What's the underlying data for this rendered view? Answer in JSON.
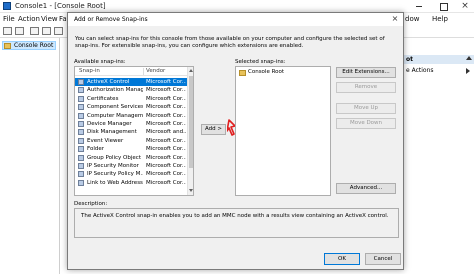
{
  "mmc": {
    "title": "Console1 - [Console Root]",
    "close_glyph": "×",
    "menu": [
      "File",
      "Action",
      "View",
      "Fa"
    ],
    "menu_right": [
      "dow",
      "Help"
    ],
    "tree_root": "Console Root",
    "actions_header": "ot",
    "actions_item": "e Actions"
  },
  "dialog": {
    "title": "Add or Remove Snap-ins",
    "close_glyph": "×",
    "intro": "You can select snap-ins for this console from those available on your computer and configure the selected set of snap-ins. For extensible snap-ins, you can configure which extensions are enabled.",
    "available_label": "Available snap-ins:",
    "col_snapin": "Snap-in",
    "col_vendor": "Vendor",
    "snapins": [
      {
        "name": "ActiveX Control",
        "vendor": "Microsoft Cor...",
        "selected": true
      },
      {
        "name": "Authorization Manager",
        "vendor": "Microsoft Cor..."
      },
      {
        "name": "Certificates",
        "vendor": "Microsoft Cor..."
      },
      {
        "name": "Component Services",
        "vendor": "Microsoft Cor..."
      },
      {
        "name": "Computer Managem...",
        "vendor": "Microsoft Cor..."
      },
      {
        "name": "Device Manager",
        "vendor": "Microsoft Cor..."
      },
      {
        "name": "Disk Management",
        "vendor": "Microsoft and..."
      },
      {
        "name": "Event Viewer",
        "vendor": "Microsoft Cor..."
      },
      {
        "name": "Folder",
        "vendor": "Microsoft Cor..."
      },
      {
        "name": "Group Policy Object ...",
        "vendor": "Microsoft Cor..."
      },
      {
        "name": "IP Security Monitor",
        "vendor": "Microsoft Cor..."
      },
      {
        "name": "IP Security Policy M...",
        "vendor": "Microsoft Cor..."
      },
      {
        "name": "Link to Web Address",
        "vendor": "Microsoft Cor..."
      }
    ],
    "add_button": "Add >",
    "selected_label": "Selected snap-ins:",
    "selected_root": "Console Root",
    "edit_extensions": "Edit Extensions...",
    "remove": "Remove",
    "move_up": "Move Up",
    "move_down": "Move Down",
    "advanced": "Advanced...",
    "description_label": "Description:",
    "description": "The ActiveX Control snap-in enables you to add an MMC node with a results view containing an ActiveX control.",
    "ok": "OK",
    "cancel": "Cancel"
  },
  "colors": {
    "selection": "#0078d7",
    "dialog_bg": "#f0f0f0",
    "cursor": "#e02020"
  }
}
